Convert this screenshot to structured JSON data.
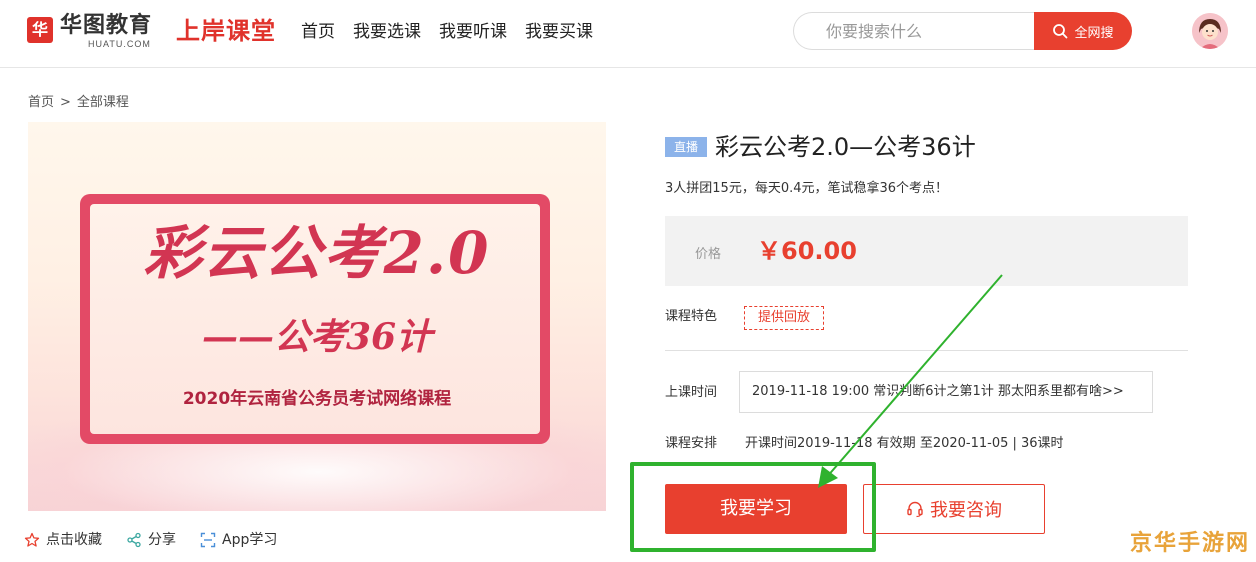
{
  "header": {
    "logo_mark": "华",
    "logo_cn": "华图教育",
    "logo_en": "HUATU.COM",
    "brand": "上岸课堂",
    "nav": [
      "首页",
      "我要选课",
      "我要听课",
      "我要买课"
    ],
    "search_placeholder": "你要搜索什么",
    "search_button": "全网搜"
  },
  "breadcrumb": {
    "home": "首页",
    "sep": ">",
    "current": "全部课程"
  },
  "banner": {
    "title": "彩云公考2.0",
    "subtitle": "——公考36计",
    "caption": "2020年云南省公务员考试网络课程"
  },
  "actions": {
    "favorite": "点击收藏",
    "share": "分享",
    "app": "App学习"
  },
  "course": {
    "badge": "直播",
    "title": "彩云公考2.0—公考36计",
    "desc": "3人拼团15元，每天0.4元，笔试稳拿36个考点！",
    "price_label": "价格",
    "price": "￥60.00",
    "feature_label": "课程特色",
    "feature_tag": "提供回放",
    "time_label": "上课时间",
    "time_value": "2019-11-18 19:00 常识判断6计之第1计 那太阳系里都有啥>>",
    "schedule_label": "课程安排",
    "schedule_value": "开课时间2019-11-18 有效期 至2020-11-05 | 36课时",
    "study_button": "我要学习",
    "consult_button": "我要咨询"
  },
  "watermark": "京华手游网",
  "colors": {
    "accent": "#e8402f",
    "annotation": "#2fb22e",
    "badge": "#8cb3ea"
  }
}
